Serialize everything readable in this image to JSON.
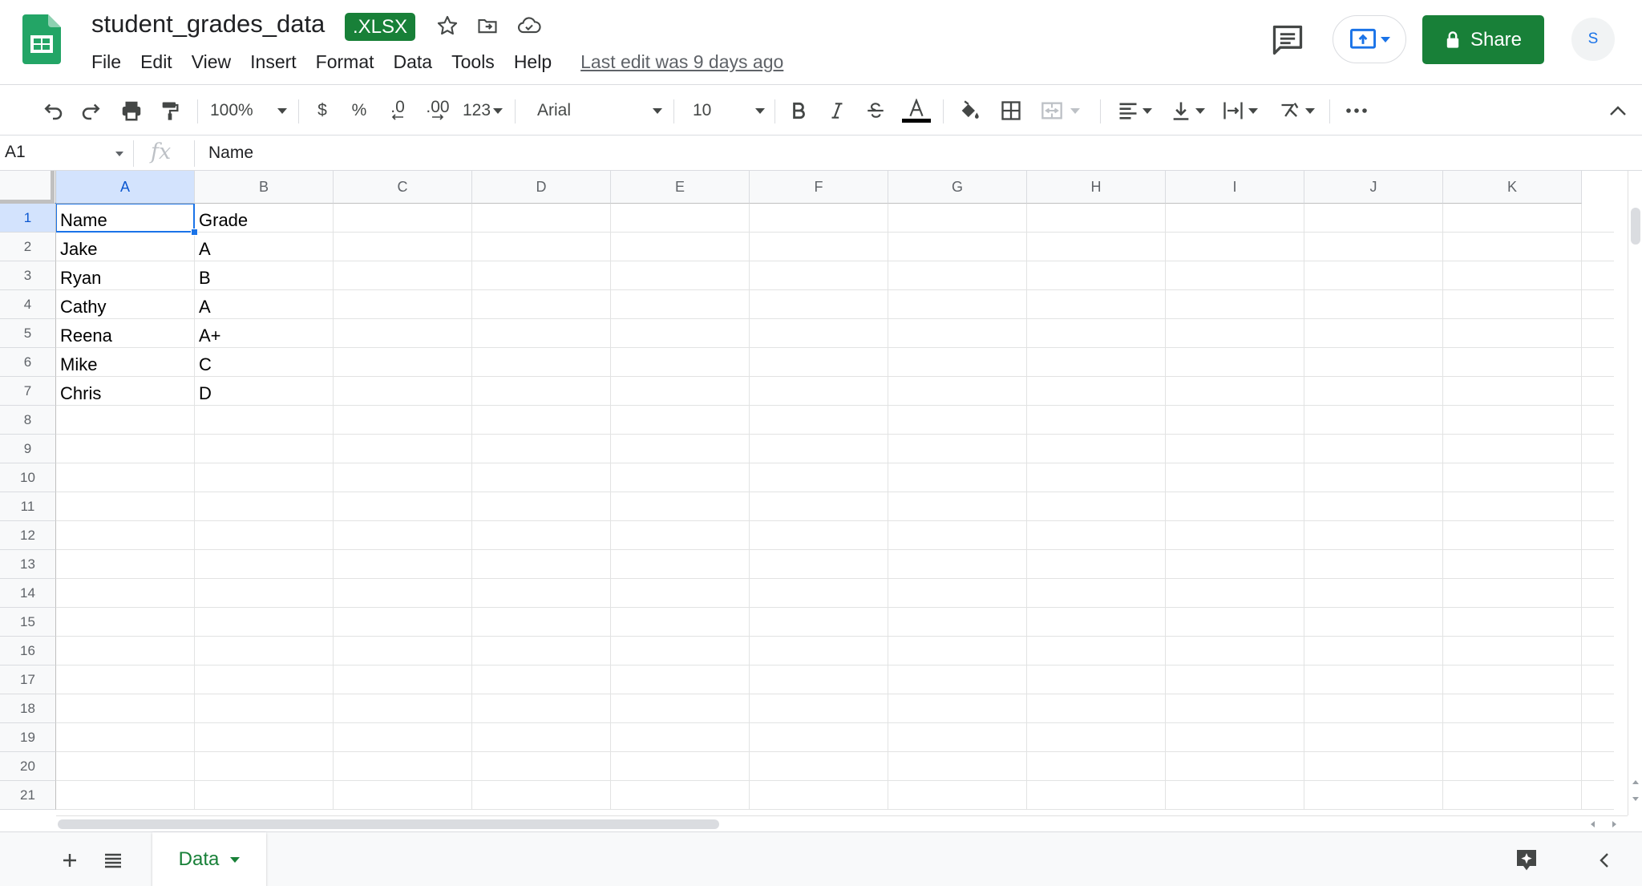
{
  "doc": {
    "title": "student_grades_data",
    "format_badge": ".XLSX",
    "last_edit": "Last edit was 9 days ago"
  },
  "menu": [
    "File",
    "Edit",
    "View",
    "Insert",
    "Format",
    "Data",
    "Tools",
    "Help"
  ],
  "header_actions": {
    "share_label": "Share",
    "avatar_initial": "S"
  },
  "toolbar": {
    "zoom": "100%",
    "currency": "$",
    "percent": "%",
    "decrease_decimal": ".0",
    "increase_decimal": ".00",
    "more_formats": "123",
    "font": "Arial",
    "font_size": "10",
    "text_color": "#000000"
  },
  "formula_bar": {
    "cell_ref": "A1",
    "fx": "fx",
    "value": "Name"
  },
  "grid": {
    "columns": [
      "A",
      "B",
      "C",
      "D",
      "E",
      "F",
      "G",
      "H",
      "I",
      "J",
      "K"
    ],
    "rows": [
      "1",
      "2",
      "3",
      "4",
      "5",
      "6",
      "7",
      "8",
      "9",
      "10",
      "11",
      "12",
      "13",
      "14",
      "15",
      "16",
      "17",
      "18",
      "19",
      "20",
      "21"
    ],
    "selected_cell": "A1",
    "data": [
      [
        "Name",
        "Grade"
      ],
      [
        "Jake",
        "A"
      ],
      [
        "Ryan",
        "B"
      ],
      [
        "Cathy",
        "A"
      ],
      [
        "Reena",
        "A+"
      ],
      [
        "Mike",
        "C"
      ],
      [
        "Chris",
        "D"
      ]
    ]
  },
  "sheets": {
    "active": "Data"
  },
  "colors": {
    "brand_green": "#188038",
    "accent_blue": "#1a73e8"
  }
}
